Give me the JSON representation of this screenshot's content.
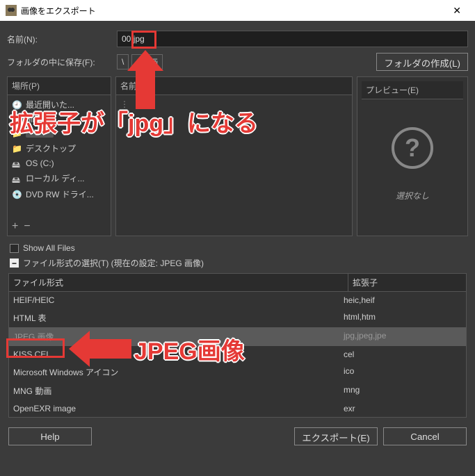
{
  "titlebar": {
    "title": "画像をエクスポート"
  },
  "name_row": {
    "label": "名前(N):",
    "value_pre": "00",
    "value_ext": ".jpg"
  },
  "folder_row": {
    "label": "フォルダの中に保存(F):",
    "path_icon": "\\",
    "path_seg": "画",
    "create_btn": "フォルダの作成(L)"
  },
  "places": {
    "header": "場所(P)",
    "items": [
      {
        "icon": "clock",
        "label": "最近開いた..."
      },
      {
        "icon": "folder",
        "label": "bin"
      },
      {
        "icon": "folder",
        "label": ""
      },
      {
        "icon": "folder",
        "label": "デスクトップ"
      },
      {
        "icon": "drive",
        "label": "OS (C:)"
      },
      {
        "icon": "drive",
        "label": "ローカル ディ..."
      },
      {
        "icon": "disc",
        "label": "DVD RW ドライ..."
      }
    ]
  },
  "filelist": {
    "header": "名前"
  },
  "preview": {
    "header": "プレビュー(E)",
    "none": "選択なし"
  },
  "showall": {
    "label": "Show All Files"
  },
  "filechoice": {
    "label": "ファイル形式の選択(T) (現在の設定: JPEG 画像)"
  },
  "formats": {
    "col_type": "ファイル形式",
    "col_ext": "拡張子",
    "rows": [
      {
        "type": "HEIF/HEIC",
        "ext": "heic,heif",
        "selected": false
      },
      {
        "type": "HTML 表",
        "ext": "html,htm",
        "selected": false
      },
      {
        "type": "JPEG 画像",
        "ext": "jpg,jpeg,jpe",
        "selected": true
      },
      {
        "type": "KISS CEL",
        "ext": "cel",
        "selected": false
      },
      {
        "type": "Microsoft Windows アイコン",
        "ext": "ico",
        "selected": false
      },
      {
        "type": "MNG 動画",
        "ext": "mng",
        "selected": false
      },
      {
        "type": "OpenEXR image",
        "ext": "exr",
        "selected": false
      }
    ]
  },
  "buttons": {
    "help": "Help",
    "export": "エクスポート(E)",
    "cancel": "Cancel"
  },
  "annotations": {
    "top": "拡張子が「jpg」になる",
    "bottom": "JPEG画像"
  }
}
